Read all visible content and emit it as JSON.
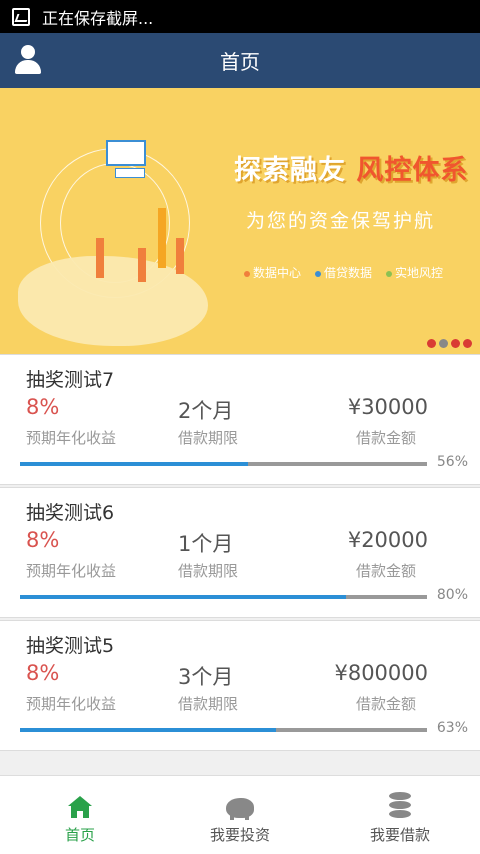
{
  "status_bar": {
    "text": "正在保存截屏..."
  },
  "app_bar": {
    "title": "首页"
  },
  "banner": {
    "title_part1": "探索融友",
    "title_part2": "风控体系",
    "subtitle": "为您的资金保驾护航",
    "tags": [
      "数据中心",
      "借贷数据",
      "实地风控"
    ],
    "tag_colors": [
      "#f07f3c",
      "#3b8ed4",
      "#8cc152"
    ],
    "page_count": 4,
    "active_page": 1
  },
  "loans": [
    {
      "name": "抽奖测试7",
      "rate": "8%",
      "rate_label": "预期年化收益",
      "term": "2个月",
      "term_label": "借款期限",
      "amount": "¥30000",
      "amount_label": "借款金额",
      "progress": 56,
      "progress_label": "56%"
    },
    {
      "name": "抽奖测试6",
      "rate": "8%",
      "rate_label": "预期年化收益",
      "term": "1个月",
      "term_label": "借款期限",
      "amount": "¥20000",
      "amount_label": "借款金额",
      "progress": 80,
      "progress_label": "80%"
    },
    {
      "name": "抽奖测试5",
      "rate": "8%",
      "rate_label": "预期年化收益",
      "term": "3个月",
      "term_label": "借款期限",
      "amount": "¥800000",
      "amount_label": "借款金额",
      "progress": 63,
      "progress_label": "63%"
    }
  ],
  "tab_bar": {
    "tabs": [
      {
        "label": "首页",
        "icon": "home-icon",
        "active": true
      },
      {
        "label": "我要投资",
        "icon": "piggy-bank-icon",
        "active": false
      },
      {
        "label": "我要借款",
        "icon": "database-icon",
        "active": false
      }
    ]
  },
  "colors": {
    "app_bar": "#2b4a73",
    "accent_green": "#2aa14a",
    "rate_red": "#d9534f",
    "progress_blue": "#2b8fd6",
    "banner_bg": "#f9d262"
  }
}
